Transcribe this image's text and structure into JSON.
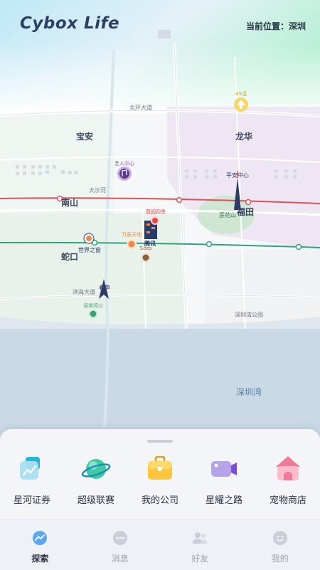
{
  "header": {
    "title": "Cybox Life",
    "location": "当前位置：深圳"
  },
  "map": {
    "districts": [
      "宝安",
      "龙华",
      "南山",
      "福田",
      "蛇口"
    ],
    "roads": [
      "北环大道",
      "大沙河",
      "滨海大道",
      "深圳湾公园"
    ],
    "water": "深圳湾",
    "pois": [
      {
        "name": "45话",
        "icon": "flame-icon",
        "color": "#e8b84a"
      },
      {
        "name": "艺人中心",
        "icon": "music-note-icon",
        "color": "#8b5fbf"
      },
      {
        "name": "平安中心",
        "icon": "tower-icon",
        "color": "#d44"
      },
      {
        "name": "莲花山",
        "icon": "park-icon",
        "color": "#3a8a5a"
      },
      {
        "name": "蔚园四季",
        "icon": "pin-icon",
        "color": "#e14a4a"
      },
      {
        "name": "腾讯",
        "icon": "building-icon",
        "color": "#2a3a6a"
      },
      {
        "name": "万象天地",
        "icon": "pin-icon",
        "color": "#f08a45"
      },
      {
        "name": "Sees",
        "icon": "pin-icon",
        "color": "#8a6040"
      },
      {
        "name": "世界之窗",
        "icon": "pin-icon",
        "color": "#f08a45"
      },
      {
        "name": "春笋",
        "icon": "tower-icon",
        "color": "#2a3a6a"
      },
      {
        "name": "深圳湾公",
        "icon": "pin-icon",
        "color": "#3aa56a"
      }
    ]
  },
  "features": [
    {
      "label": "星河证券",
      "icon": "stock-chart-icon"
    },
    {
      "label": "超级联赛",
      "icon": "planet-icon"
    },
    {
      "label": "我的公司",
      "icon": "briefcase-icon"
    },
    {
      "label": "星耀之路",
      "icon": "video-camera-icon"
    },
    {
      "label": "宠物商店",
      "icon": "pet-house-icon"
    }
  ],
  "tabs": [
    {
      "label": "探索",
      "icon": "explore-icon",
      "active": true
    },
    {
      "label": "消息",
      "icon": "message-icon",
      "active": false
    },
    {
      "label": "好友",
      "icon": "friends-icon",
      "active": false
    },
    {
      "label": "我的",
      "icon": "profile-icon",
      "active": false
    }
  ],
  "colors": {
    "metro_line_red": "#e0505a",
    "metro_line_green": "#2fa37e",
    "sky_top": "#a6e7f2",
    "land_purple": "#efe6f3",
    "land_green": "#e7f2ea",
    "water": "#cad9e6",
    "text_dark": "#2f3e63"
  }
}
